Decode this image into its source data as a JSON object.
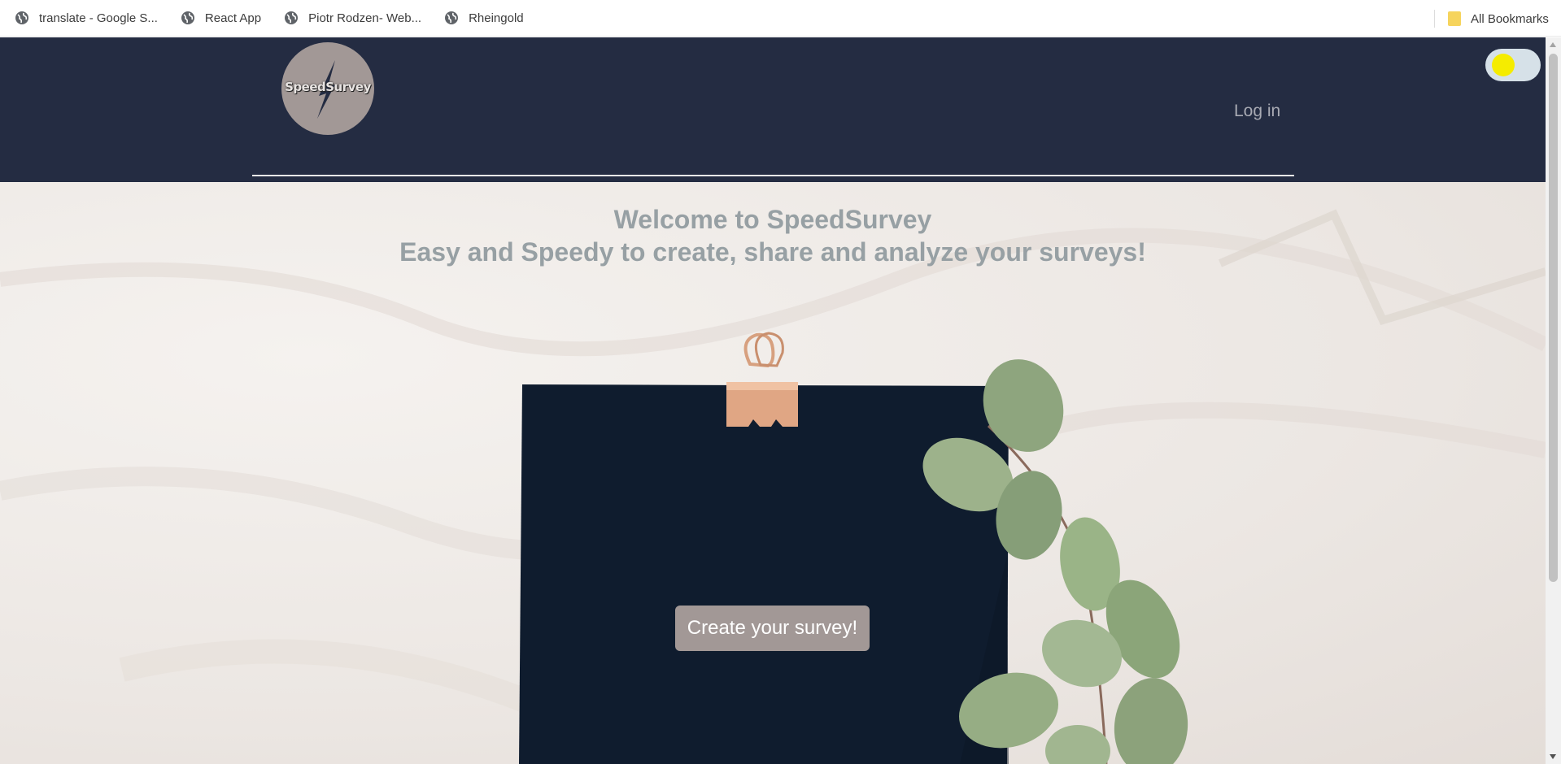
{
  "bookmarks": {
    "items": [
      {
        "label": "translate - Google S...",
        "icon": "globe-icon"
      },
      {
        "label": "React App",
        "icon": "globe-icon"
      },
      {
        "label": "Piotr Rodzen- Web...",
        "icon": "globe-icon"
      },
      {
        "label": "Rheingold",
        "icon": "globe-icon"
      }
    ],
    "all_bookmarks": "All Bookmarks"
  },
  "header": {
    "logo_text": "SpeedSurvey",
    "login_label": "Log in",
    "background": "#242c42",
    "theme_toggle": {
      "icon": "sun-icon",
      "knob_color": "#f5ec00"
    }
  },
  "hero": {
    "title_line1": "Welcome to SpeedSurvey",
    "title_line2": "Easy and Speedy to create, share and analyze your surveys!",
    "cta_label": "Create your survey!",
    "accent_color": "#a29896"
  }
}
